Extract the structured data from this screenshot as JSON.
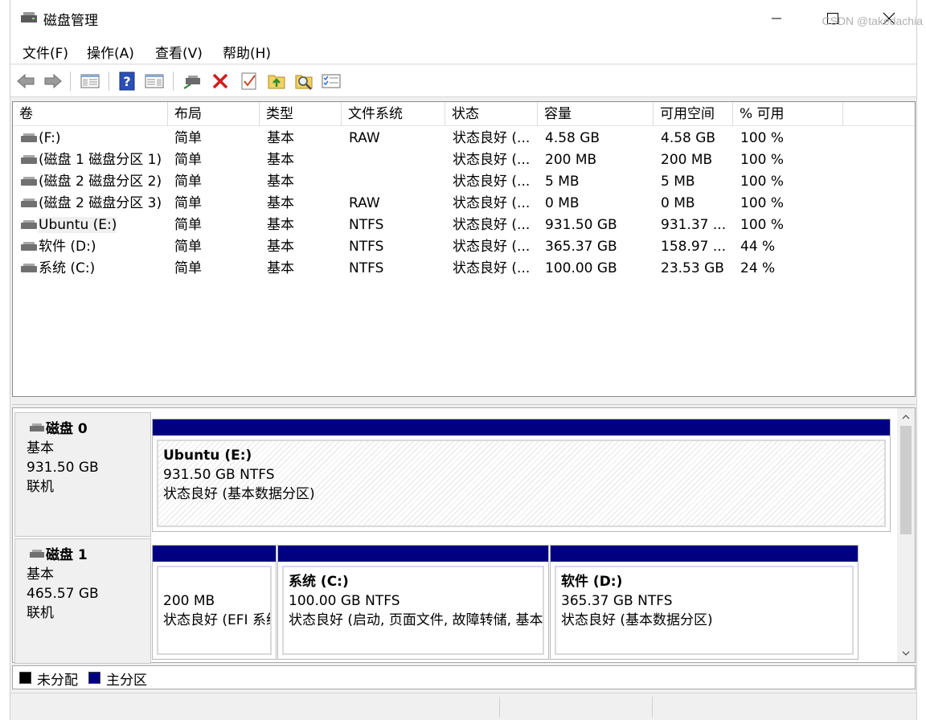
{
  "window": {
    "title": "磁盘管理"
  },
  "menu": [
    "文件(F)",
    "操作(A)",
    "查看(V)",
    "帮助(H)"
  ],
  "toolbar": [
    "back-icon",
    "forward-icon",
    "console-tree-icon",
    "help-icon",
    "properties-view-icon",
    "connect-drive-icon",
    "delete-icon",
    "check-icon",
    "import-icon",
    "search-icon",
    "settings-list-icon"
  ],
  "columns": [
    "卷",
    "布局",
    "类型",
    "文件系统",
    "状态",
    "容量",
    "可用空间",
    "% 可用"
  ],
  "volumes": [
    {
      "name": "(F:)",
      "layout": "简单",
      "type": "基本",
      "fs": "RAW",
      "status": "状态良好 (...",
      "capacity": "4.58 GB",
      "free": "4.58 GB",
      "pct": "100 %"
    },
    {
      "name": "(磁盘 1 磁盘分区 1)",
      "layout": "简单",
      "type": "基本",
      "fs": "",
      "status": "状态良好 (...",
      "capacity": "200 MB",
      "free": "200 MB",
      "pct": "100 %"
    },
    {
      "name": "(磁盘 2 磁盘分区 2)",
      "layout": "简单",
      "type": "基本",
      "fs": "",
      "status": "状态良好 (...",
      "capacity": "5 MB",
      "free": "5 MB",
      "pct": "100 %"
    },
    {
      "name": "(磁盘 2 磁盘分区 3)",
      "layout": "简单",
      "type": "基本",
      "fs": "RAW",
      "status": "状态良好 (...",
      "capacity": "0 MB",
      "free": "0 MB",
      "pct": "100 %"
    },
    {
      "name": "Ubuntu (E:)",
      "layout": "简单",
      "type": "基本",
      "fs": "NTFS",
      "status": "状态良好 (...",
      "capacity": "931.50 GB",
      "free": "931.37 ...",
      "pct": "100 %"
    },
    {
      "name": "软件 (D:)",
      "layout": "简单",
      "type": "基本",
      "fs": "NTFS",
      "status": "状态良好 (...",
      "capacity": "365.37 GB",
      "free": "158.97 ...",
      "pct": "44 %"
    },
    {
      "name": "系统 (C:)",
      "layout": "简单",
      "type": "基本",
      "fs": "NTFS",
      "status": "状态良好 (...",
      "capacity": "100.00 GB",
      "free": "23.53 GB",
      "pct": "24 %"
    }
  ],
  "disks": [
    {
      "name": "磁盘 0",
      "kind": "基本",
      "size": "931.50 GB",
      "state": "联机",
      "partitions": [
        {
          "title": "Ubuntu  (E:)",
          "line1": "931.50 GB NTFS",
          "line2": "状态良好 (基本数据分区)"
        }
      ]
    },
    {
      "name": "磁盘 1",
      "kind": "基本",
      "size": "465.57 GB",
      "state": "联机",
      "partitions": [
        {
          "title": "",
          "line1": "200 MB",
          "line2": "状态良好 (EFI 系统"
        },
        {
          "title": "系统  (C:)",
          "line1": "100.00 GB NTFS",
          "line2": "状态良好 (启动, 页面文件, 故障转储, 基本"
        },
        {
          "title": "软件  (D:)",
          "line1": "365.37 GB NTFS",
          "line2": "状态良好 (基本数据分区)"
        }
      ]
    }
  ],
  "legend": [
    {
      "label": "未分配",
      "color": "#000000"
    },
    {
      "label": "主分区",
      "color": "#000080"
    }
  ],
  "watermark": "CSDN @takedachia"
}
